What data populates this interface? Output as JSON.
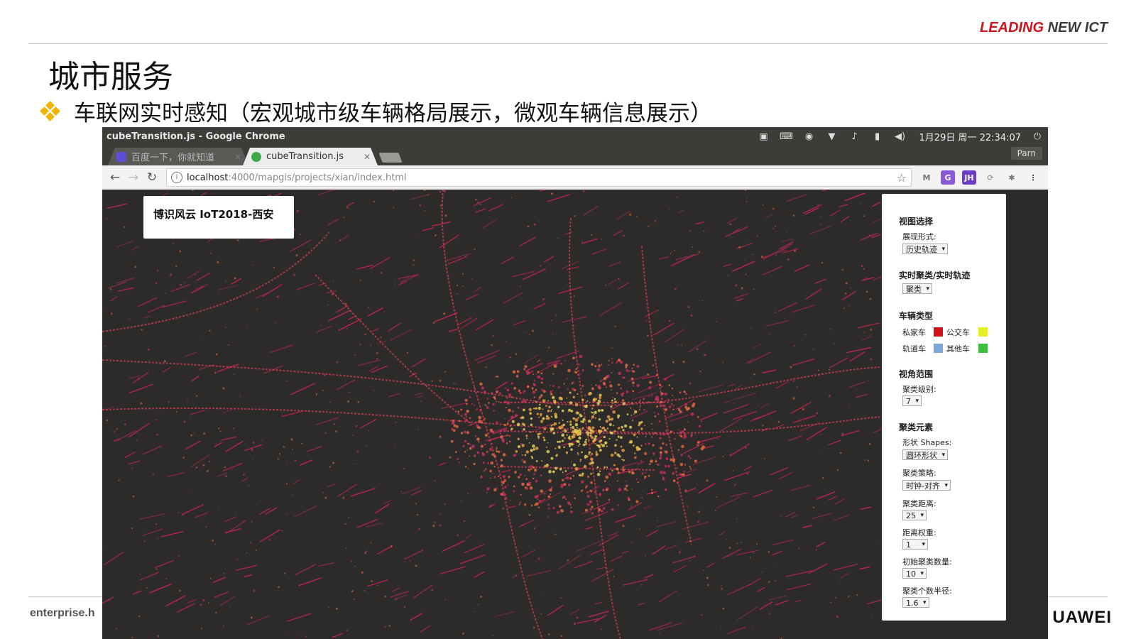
{
  "slide": {
    "brand_red": "LEADING",
    "brand_dark": "NEW ICT",
    "title": "城市服务",
    "bullet": "车联网实时感知（宏观城市级车辆格局展示，微观车辆信息展示）",
    "footer_left": "enterprise.h",
    "footer_right": "UAWEI",
    "colors": {
      "brand_red": "#d0121b",
      "bullet": "#f2b200"
    }
  },
  "os_bar": {
    "window_title": "cubeTransition.js - Google Chrome",
    "clock": "1月29日 周一 22:34:07",
    "tray_icons": [
      "screen-icon",
      "keyboard-icon",
      "camera-icon",
      "wifi-icon",
      "bell-icon",
      "battery-icon",
      "volume-icon",
      "power-icon"
    ]
  },
  "browser": {
    "tabs": [
      {
        "label": "百度一下，你就知道",
        "active": false,
        "favicon": "baidu-paw-icon"
      },
      {
        "label": "cubeTransition.js",
        "active": true,
        "favicon": "green-refresh-icon"
      }
    ],
    "profile": "Parn",
    "url_host": "localhost",
    "url_path": ":4000/mapgis/projects/xian/index.html",
    "extensions": [
      "gmail-icon",
      "translate-icon",
      "jh-icon",
      "sync-icon",
      "settings-extension-icon"
    ]
  },
  "map": {
    "title": "博识风云 IoT2018-西安",
    "background": "#2d2b29"
  },
  "panel": {
    "view_section": "视图选择",
    "display_mode_label": "展现形式:",
    "display_mode_value": "历史轨迹",
    "cluster_section": "实时聚类/实时轨迹",
    "cluster_value": "聚类",
    "vehicle_section": "车辆类型",
    "vehicles": [
      {
        "label": "私家车",
        "color": "#d0121b"
      },
      {
        "label": "公交车",
        "color": "#e6f02a"
      },
      {
        "label": "轨道车",
        "color": "#7aa8d8"
      },
      {
        "label": "其他车",
        "color": "#3cbf3c"
      }
    ],
    "view_range_section": "视角范围",
    "cluster_level_label": "聚类级别:",
    "cluster_level_value": "7",
    "cluster_elements_section": "聚类元素",
    "shape_label": "形状 Shapes:",
    "shape_value": "圆环形状",
    "strategy_label": "聚类策略:",
    "strategy_value": "时钟-对齐",
    "distance_label": "聚类距离:",
    "distance_value": "25",
    "weight_label": "距离权重:",
    "weight_value": "1",
    "initial_count_label": "初始聚类数量:",
    "initial_count_value": "10",
    "radius_label": "聚类个数半径:",
    "radius_value": "1.6"
  }
}
